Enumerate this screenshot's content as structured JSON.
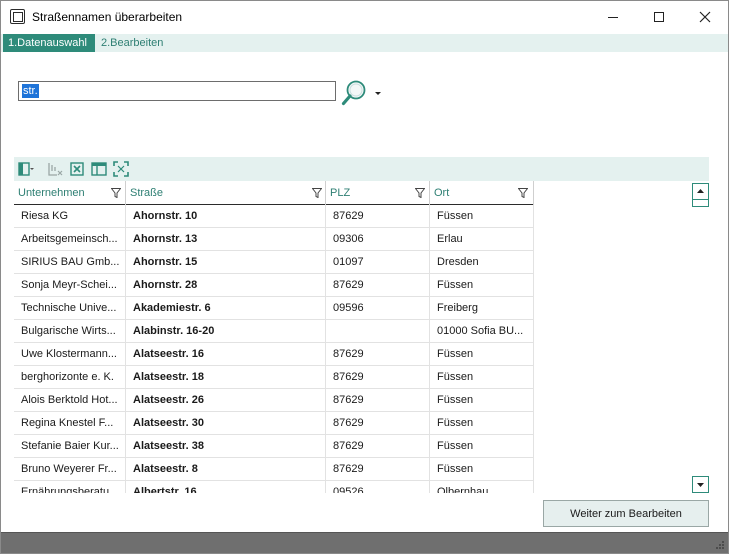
{
  "window": {
    "title": "Straßennamen überarbeiten"
  },
  "icons": {
    "app": "app-window-icon",
    "minimize": "minimize-icon",
    "maximize": "maximize-icon",
    "close": "close-icon",
    "search": "search-icon",
    "dropdown": "chevron-down-icon",
    "filter": "filter-icon"
  },
  "colors": {
    "accent": "#2e8b7a",
    "tab_bg": "#e4f1ef",
    "selection": "#1e73d8"
  },
  "tabs": [
    {
      "label": "1.Datenauswahl",
      "active": true
    },
    {
      "label": "2.Bearbeiten",
      "active": false
    }
  ],
  "search": {
    "value": "str."
  },
  "toolbar": {
    "icons": [
      "column-chooser-icon",
      "clear-filter-icon",
      "export-excel-icon",
      "layout-icon",
      "fit-columns-icon"
    ]
  },
  "table": {
    "columns": [
      "Unternehmen",
      "Straße",
      "PLZ",
      "Ort"
    ],
    "rows": [
      [
        "Riesa KG",
        "Ahornstr. 10",
        "87629",
        "Füssen"
      ],
      [
        "Arbeitsgemeinsch...",
        "Ahornstr. 13",
        "09306",
        "Erlau"
      ],
      [
        "SIRIUS BAU Gmb...",
        "Ahornstr. 15",
        "01097",
        "Dresden"
      ],
      [
        "Sonja Meyr-Schei...",
        "Ahornstr. 28",
        "87629",
        "Füssen"
      ],
      [
        "Technische Unive...",
        "Akademiestr. 6",
        "09596",
        "Freiberg"
      ],
      [
        "Bulgarische Wirts...",
        "Alabinstr. 16-20",
        "",
        "01000 Sofia BU..."
      ],
      [
        "Uwe Klostermann...",
        "Alatseestr. 16",
        "87629",
        "Füssen"
      ],
      [
        "berghorizonte e. K.",
        "Alatseestr. 18",
        "87629",
        "Füssen"
      ],
      [
        "Alois Berktold Hot...",
        "Alatseestr. 26",
        "87629",
        "Füssen"
      ],
      [
        "Regina Knestel F...",
        "Alatseestr. 30",
        "87629",
        "Füssen"
      ],
      [
        "Stefanie Baier Kur...",
        "Alatseestr. 38",
        "87629",
        "Füssen"
      ],
      [
        "Bruno Weyerer Fr...",
        "Alatseestr. 8",
        "87629",
        "Füssen"
      ],
      [
        "Ernährungsberatu...",
        "Albertstr. 16",
        "09526",
        "Olbernhau"
      ]
    ]
  },
  "buttons": {
    "next": "Weiter zum Bearbeiten"
  }
}
